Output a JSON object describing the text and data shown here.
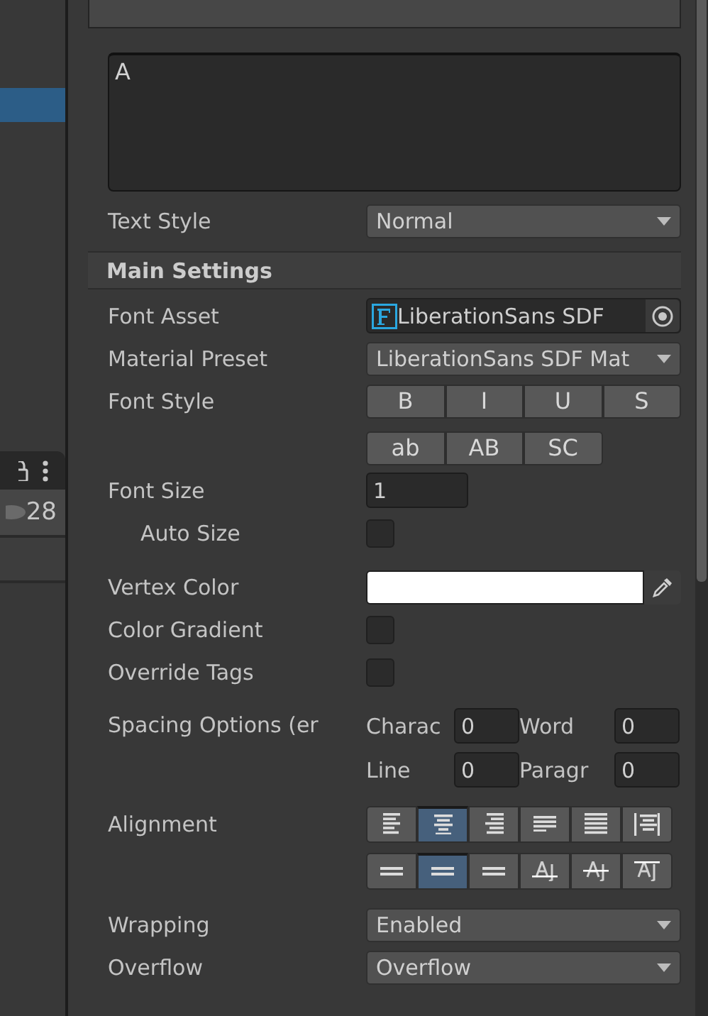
{
  "hierarchy": {
    "rows": [
      {
        "selected": true
      }
    ],
    "toolbar": {
      "visible_count": "28"
    }
  },
  "text_input": {
    "value": "A"
  },
  "text_style": {
    "label": "Text Style",
    "value": "Normal"
  },
  "main_settings": {
    "title": "Main Settings",
    "groups": [
      {
        "fields": [
          {
            "kind": "object",
            "label": "Font Asset",
            "value": "LiberationSans SDF"
          },
          {
            "kind": "dropdown",
            "label": "Material Preset",
            "value": "LiberationSans SDF Mat"
          },
          {
            "kind": "buttons",
            "label": "Font Style",
            "rows": [
              [
                {
                  "text": "B",
                  "selected": false
                },
                {
                  "text": "I",
                  "selected": false
                },
                {
                  "text": "U",
                  "selected": false
                },
                {
                  "text": "S",
                  "selected": false
                }
              ],
              [
                {
                  "text": "ab",
                  "selected": false
                },
                {
                  "text": "AB",
                  "selected": false
                },
                {
                  "text": "SC",
                  "selected": false
                }
              ]
            ]
          },
          {
            "kind": "number",
            "label": "Font Size",
            "value": "1",
            "children": [
              {
                "kind": "checkbox",
                "label": "Auto Size",
                "checked": false
              }
            ]
          }
        ]
      },
      {
        "fields": [
          {
            "kind": "color",
            "label": "Vertex Color",
            "color": "#ffffff"
          },
          {
            "kind": "checkbox",
            "label": "Color Gradient",
            "checked": false
          },
          {
            "kind": "checkbox",
            "label": "Override Tags",
            "checked": false
          }
        ]
      },
      {
        "fields": [
          {
            "kind": "spacing",
            "label": "Spacing Options (er",
            "cells": [
              {
                "label": "Charac",
                "value": "0"
              },
              {
                "label": "Word",
                "value": "0"
              },
              {
                "label": "Line",
                "value": "0"
              },
              {
                "label": "Paragr",
                "value": "0"
              }
            ]
          }
        ]
      },
      {
        "fields": [
          {
            "kind": "alignment",
            "label": "Alignment",
            "rows": [
              [
                {
                  "kind": "left",
                  "selected": false
                },
                {
                  "kind": "center",
                  "selected": true
                },
                {
                  "kind": "right",
                  "selected": false
                },
                {
                  "kind": "justified",
                  "selected": false
                },
                {
                  "kind": "flush",
                  "selected": false
                },
                {
                  "kind": "geometry",
                  "selected": false
                }
              ],
              [
                {
                  "kind": "top",
                  "selected": false
                },
                {
                  "kind": "middle",
                  "selected": true
                },
                {
                  "kind": "bottom",
                  "selected": false
                },
                {
                  "kind": "baseline",
                  "selected": false
                },
                {
                  "kind": "midline",
                  "selected": false
                },
                {
                  "kind": "capline",
                  "selected": false
                }
              ]
            ]
          }
        ]
      },
      {
        "fields": [
          {
            "kind": "dropdown",
            "label": "Wrapping",
            "value": "Enabled"
          },
          {
            "kind": "dropdown",
            "label": "Overflow",
            "value": "Overflow"
          }
        ]
      }
    ]
  }
}
